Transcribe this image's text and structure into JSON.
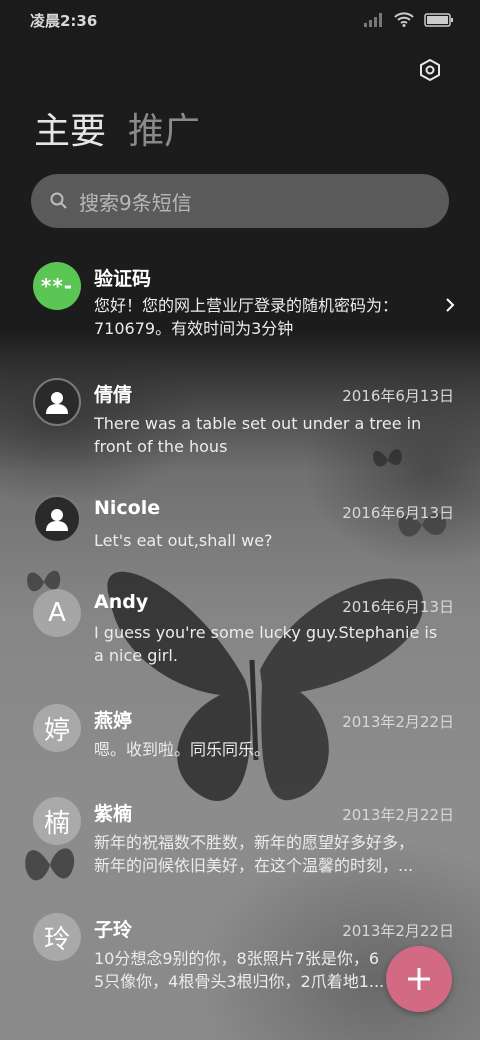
{
  "status_bar": {
    "time": "凌晨2:36"
  },
  "tabs": [
    {
      "label": "主要",
      "active": true
    },
    {
      "label": "推广",
      "active": false
    }
  ],
  "search": {
    "placeholder": "搜索9条短信"
  },
  "messages": [
    {
      "sender": "验证码",
      "avatar_type": "code",
      "avatar_text": "**-",
      "date": "",
      "preview": "您好！您的网上营业厅登录的随机密码为：\n710679。有效时间为3分钟"
    },
    {
      "sender": "倩倩",
      "avatar_type": "person",
      "avatar_text": "",
      "date": "2016年6月13日",
      "preview": "There was a table set out under a tree in\nfront of the hous"
    },
    {
      "sender": "Nicole",
      "avatar_type": "person",
      "avatar_text": "",
      "date": "2016年6月13日",
      "preview": "Let's eat out,shall we?"
    },
    {
      "sender": "Andy",
      "avatar_type": "letter",
      "avatar_text": "A",
      "date": "2016年6月13日",
      "preview": "I guess you're some lucky guy.Stephanie is\na nice girl."
    },
    {
      "sender": "燕婷",
      "avatar_type": "letter",
      "avatar_text": "婷",
      "date": "2013年2月22日",
      "preview": "嗯。收到啦。同乐同乐。"
    },
    {
      "sender": "紫楠",
      "avatar_type": "letter",
      "avatar_text": "楠",
      "date": "2013年2月22日",
      "preview": "新年的祝福数不胜数，新年的愿望好多好多，\n新年的问候依旧美好，在这个温馨的时刻，..."
    },
    {
      "sender": "子玲",
      "avatar_type": "letter",
      "avatar_text": "玲",
      "date": "2013年2月22日",
      "preview": "10分想念9别的你，8张照片7张是你，6\n5只像你，4根骨头3根归你，2爪着地1..."
    }
  ],
  "colors": {
    "accent_fab": "#d16a82",
    "code_avatar": "#5cc654"
  }
}
